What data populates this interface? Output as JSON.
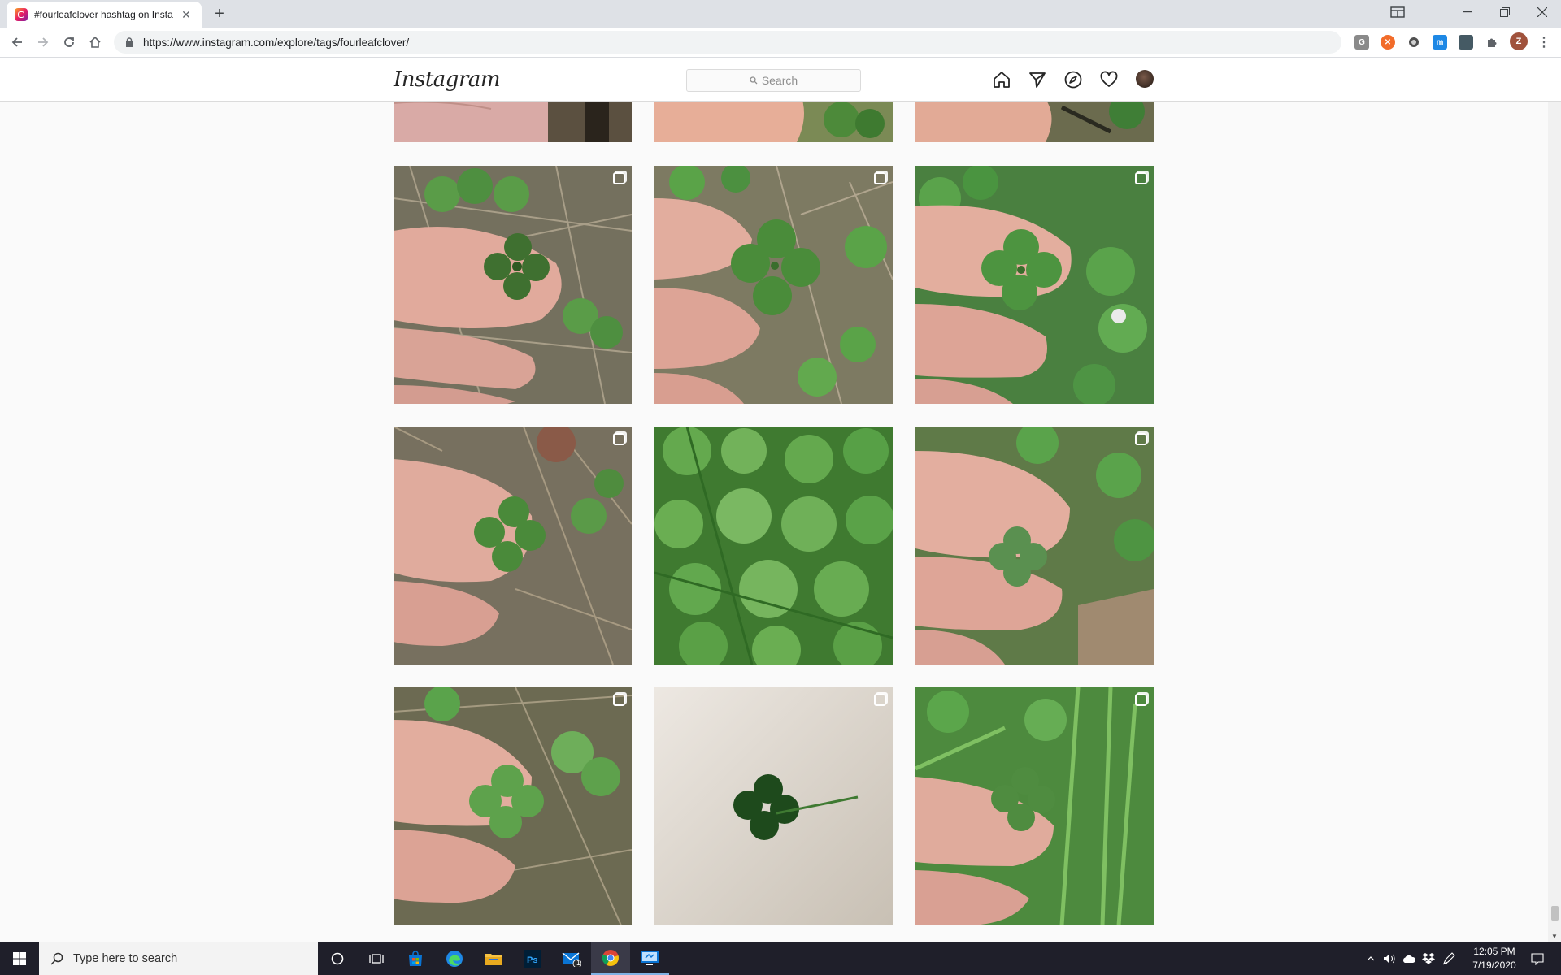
{
  "browser": {
    "tab_title": "#fourleafclover hashtag on Insta",
    "url": "https://www.instagram.com/explore/tags/fourleafclover/",
    "profile_initial": "Z",
    "extensions": [
      {
        "name": "grammarly-icon",
        "label": "G",
        "color": "#8a8a8a"
      },
      {
        "name": "honey-icon",
        "label": "h",
        "color": "#f26c2a"
      },
      {
        "name": "dark-reader-icon",
        "label": "",
        "color": "#505050"
      },
      {
        "name": "m-extension-icon",
        "label": "m",
        "color": "#1e88e5"
      },
      {
        "name": "reader-extension-icon",
        "label": "",
        "color": "#455a64"
      },
      {
        "name": "puzzle-icon",
        "label": "",
        "color": "#5f6368"
      }
    ]
  },
  "instagram": {
    "logo": "Instagram",
    "search_placeholder": "Search",
    "nav_icons": [
      "home-icon",
      "direct-messages-icon",
      "explore-icon",
      "activity-heart-icon",
      "profile-avatar"
    ]
  },
  "posts": [
    {
      "id": "post-r0-c0",
      "multi": false
    },
    {
      "id": "post-r0-c1",
      "multi": false
    },
    {
      "id": "post-r0-c2",
      "multi": false
    },
    {
      "id": "post-r1-c0",
      "multi": true
    },
    {
      "id": "post-r1-c1",
      "multi": true
    },
    {
      "id": "post-r1-c2",
      "multi": true
    },
    {
      "id": "post-r2-c0",
      "multi": true
    },
    {
      "id": "post-r2-c1",
      "multi": false
    },
    {
      "id": "post-r2-c2",
      "multi": true
    },
    {
      "id": "post-r3-c0",
      "multi": true
    },
    {
      "id": "post-r3-c1",
      "multi": true
    },
    {
      "id": "post-r3-c2",
      "multi": true
    }
  ],
  "taskbar": {
    "search_placeholder": "Type here to search",
    "mail_badge": "1",
    "time": "12:05 PM",
    "date": "7/19/2020"
  },
  "colors": {
    "skin": "#e8b8a6",
    "clover": "#4a8a3a",
    "ground": "#8a7a62",
    "grass": "#5fa84a"
  }
}
